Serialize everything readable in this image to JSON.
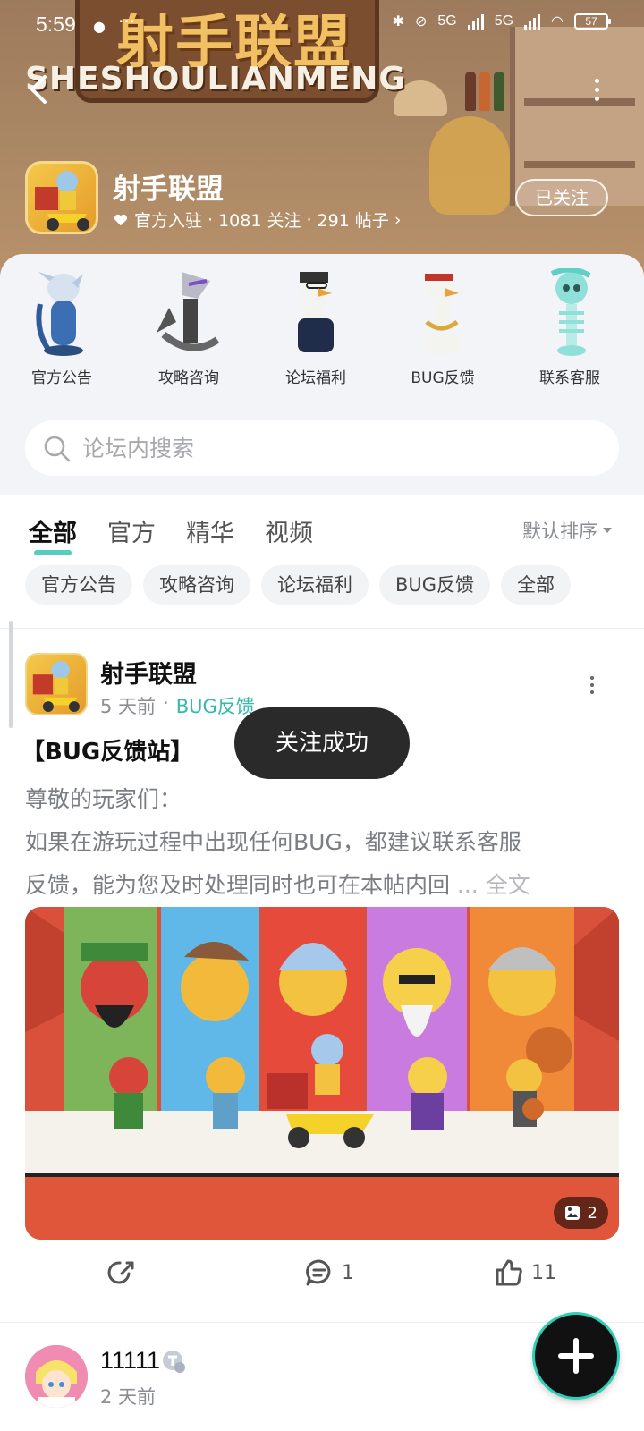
{
  "status_bar": {
    "time": "5:59",
    "extra": "···",
    "net1": "5G",
    "net2": "5G",
    "battery": "57"
  },
  "header": {
    "logo_cn": "射手联盟",
    "logo_en": "SHESHOULIANMENG",
    "forum_name": "射手联盟",
    "official": "官方入驻",
    "followers": "1081 关注",
    "posts": "291 帖子",
    "dot": "·",
    "chevron": "›",
    "follow_button": "已关注"
  },
  "categories": [
    {
      "label": "官方公告",
      "icon": "official-announcement-icon"
    },
    {
      "label": "攻略咨询",
      "icon": "strategy-icon"
    },
    {
      "label": "论坛福利",
      "icon": "welfare-icon"
    },
    {
      "label": "BUG反馈",
      "icon": "bug-feedback-icon"
    },
    {
      "label": "联系客服",
      "icon": "customer-service-icon"
    }
  ],
  "search": {
    "placeholder": "论坛内搜索"
  },
  "tabs": [
    {
      "label": "全部",
      "active": true
    },
    {
      "label": "官方",
      "active": false
    },
    {
      "label": "精华",
      "active": false
    },
    {
      "label": "视频",
      "active": false
    }
  ],
  "sort": {
    "label": "默认排序"
  },
  "chips": [
    "官方公告",
    "攻略咨询",
    "论坛福利",
    "BUG反馈",
    "全部"
  ],
  "post": {
    "author": "射手联盟",
    "time": "5 天前",
    "dot": "·",
    "tag": "BUG反馈",
    "title": "【BUG反馈站】",
    "line1": "尊敬的玩家们：",
    "line2": " 如果在游玩过程中出现任何BUG，都建议联系客服",
    "line3": "反馈，能为您及时处理同时也可在本帖内回",
    "more": " ... 全文",
    "image_count": "2",
    "comments": "1",
    "likes": "11"
  },
  "toast": "关注成功",
  "post2": {
    "author": "11111",
    "time": "2 天前"
  },
  "colors": {
    "accent": "#35c6b4",
    "toast_bg": "#2a2a2a",
    "fab": "#111111"
  }
}
